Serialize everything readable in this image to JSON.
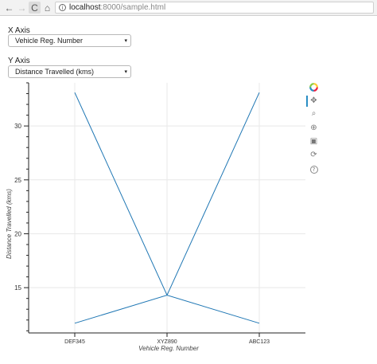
{
  "browser": {
    "back_icon": "←",
    "forward_icon": "→",
    "reload_icon": "C",
    "home_icon": "⌂",
    "info_icon": "i",
    "url_host": "localhost",
    "url_rest": ":8000/sample.html"
  },
  "controls": {
    "x_axis_label": "X Axis",
    "x_axis_value": "Vehicle Reg. Number",
    "y_axis_label": "Y Axis",
    "y_axis_value": "Distance Travelled (kms)",
    "caret": "▾"
  },
  "toolbar": {
    "tools": [
      {
        "name": "bokeh-logo-icon"
      },
      {
        "name": "pan-tool-icon",
        "glyph": "✥"
      },
      {
        "name": "zoom-tool-icon",
        "glyph": "⌕"
      },
      {
        "name": "wheel-zoom-tool-icon",
        "glyph": "⊕"
      },
      {
        "name": "save-tool-icon",
        "glyph": "▣"
      },
      {
        "name": "reset-tool-icon",
        "glyph": "⟳"
      },
      {
        "name": "help-tool-icon",
        "glyph": "?"
      }
    ]
  },
  "chart_data": {
    "type": "line",
    "categories": [
      "DEF345",
      "XYZ890",
      "ABC123"
    ],
    "series": [
      {
        "values": [
          33.1,
          14.3,
          11.7
        ],
        "color": "#1f77b4"
      },
      {
        "values": [
          11.7,
          14.3,
          33.1
        ],
        "color": "#1f77b4"
      }
    ],
    "xlabel": "Vehicle Reg. Number",
    "ylabel": "Distance Travelled (kms)",
    "ylim": [
      10.8,
      34.0
    ],
    "yticks": [
      15,
      20,
      25,
      30
    ],
    "grid": true
  }
}
